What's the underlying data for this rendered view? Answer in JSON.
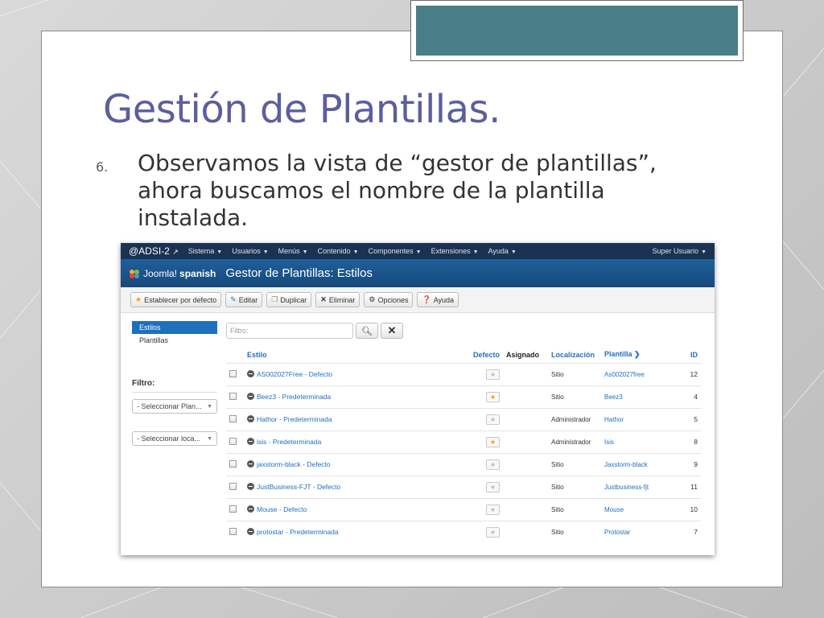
{
  "slide": {
    "title": "Gestión de Plantillas.",
    "bullet_number": "6.",
    "bullet_text": "Observamos la vista de “gestor de plantillas”, ahora buscamos el nombre de la plantilla instalada.",
    "accent_color": "#4a7e86",
    "title_color": "#5b5f9e"
  },
  "screenshot": {
    "navbar": {
      "brand": "@ADSI-2",
      "brand_icon": "external-link-icon",
      "menus": [
        "Sistema",
        "Usuarios",
        "Menús",
        "Contenido",
        "Componentes",
        "Extensiones",
        "Ayuda"
      ],
      "user": "Super Usuario"
    },
    "header": {
      "logo_text": "Joomla!",
      "logo_suffix": "spanish",
      "title": "Gestor de Plantillas: Estilos"
    },
    "toolbar": {
      "set_default": "Establecer por defecto",
      "edit": "Editar",
      "duplicate": "Duplicar",
      "delete": "Eliminar",
      "options": "Opciones",
      "help": "Ayuda"
    },
    "sidebar": {
      "items": [
        "Estilos",
        "Plantillas"
      ],
      "filter_title": "Filtro:",
      "select_template": "- Seleccionar Plan...",
      "select_location": "- Seleccionar loca..."
    },
    "search": {
      "placeholder": "Filtro:"
    },
    "table": {
      "headers": {
        "style": "Estilo",
        "default": "Defecto",
        "assigned": "Asignado",
        "location": "Localización",
        "template": "Plantilla",
        "id": "ID"
      },
      "rows": [
        {
          "style": "AS002027Free - Defecto",
          "default": false,
          "location": "Sitio",
          "template": "As002027free",
          "id": "12"
        },
        {
          "style": "Beez3 - Predeterminada",
          "default": true,
          "location": "Sitio",
          "template": "Beez3",
          "id": "4"
        },
        {
          "style": "Hathor - Predeterminada",
          "default": false,
          "location": "Administrador",
          "template": "Hathor",
          "id": "5"
        },
        {
          "style": "isis - Predeterminada",
          "default": true,
          "location": "Administrador",
          "template": "Isis",
          "id": "8"
        },
        {
          "style": "jaxstorm-black - Defecto",
          "default": false,
          "location": "Sitio",
          "template": "Jaxstorm-black",
          "id": "9"
        },
        {
          "style": "JustBusiness-FJT - Defecto",
          "default": false,
          "location": "Sitio",
          "template": "Justbusiness-fjt",
          "id": "11"
        },
        {
          "style": "Mouse - Defecto",
          "default": false,
          "location": "Sitio",
          "template": "Mouse",
          "id": "10"
        },
        {
          "style": "protostar - Predeterminada",
          "default": false,
          "location": "Sitio",
          "template": "Protostar",
          "id": "7"
        }
      ]
    }
  }
}
